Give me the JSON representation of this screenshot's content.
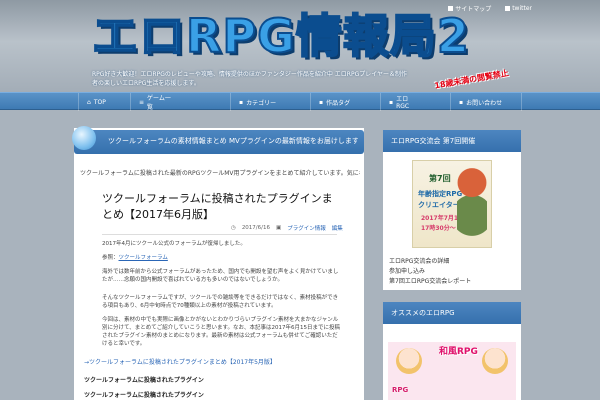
{
  "top_links": {
    "sitemap": "サイトマップ",
    "twitter": "twitter"
  },
  "header": {
    "logo": "エロRPG情報局2",
    "tagline": "RPG好き大歓迎！エロRPGのレビューや攻略、情報提供のほかファンタジー作品を紹介中 エロRPGプレイヤー＆制作者の楽しいエロRPG生活を応援します。",
    "age_notice": "18歳未満の閲覧禁止"
  },
  "nav": [
    {
      "icon": "house-icon",
      "glyph": "⌂",
      "label": "TOP"
    },
    {
      "icon": "list-icon",
      "glyph": "≡",
      "label": "ゲーム一覧"
    },
    {
      "icon": "folder-icon",
      "glyph": "▪",
      "label": "カテゴリー"
    },
    {
      "icon": "tag-icon",
      "glyph": "▪",
      "label": "作品タグ"
    },
    {
      "icon": "info-icon",
      "glyph": "▪",
      "label": "エロ RGC"
    },
    {
      "icon": "mail-icon",
      "glyph": "▪",
      "label": "お問い合わせ"
    }
  ],
  "post": {
    "header_title": "ツクールフォーラムの素材情報まとめ MVプラグインの最新情報をお届けします（定期更新）",
    "intro": "ツクールフォーラムに投稿された最新のRPGツクールMV用プラグインをまとめて紹介しています。気になるものがあればチェックしてみてください。",
    "title": "ツクールフォーラムに投稿されたプラグインまとめ【2017年6月版】",
    "date": "2017/6/16",
    "category": "プラグイン情報",
    "edit": "編集",
    "p1": "2017年4月にツクール公式のフォーラムが復帰しました。",
    "p2_prefix": "参照：",
    "p2_link": "ツクールフォーラム",
    "p3": "海外では数年前から公式フォーラムがあったため、国内でも開設を望む声をよく見かけていましたが……念願の国内開設で喜ばれている方も多いのではないでしょうか。",
    "p4": "そんなツクールフォーラムですが、ツクールでの雑談等をできるだけではなく、素材投稿ができる項目もあり、6月中旬時点で70種類以上の素材が投稿されています。",
    "p5": "今回は、素材の中でも実際に画像とかがないとわかりづらいプラグイン素材を大まかなジャンル別に分けて、まとめてご紹介していこうと思います。なお、本記事は2017年6月15日までに投稿されたプラグイン素材のまとめになります。最新の素材は公式フォーラムも併せてご確認いただけると幸いです。",
    "arrow_link": "→ツクールフォーラムに投稿されたプラグインまとめ【2017年5月版】",
    "bold1": "ツクールフォーラムに投稿されたプラグイン",
    "bold2": "ツクールフォーラムに投稿されたプラグイン"
  },
  "sidebar": {
    "box1_title": "エロRPG交流会 第7回開催",
    "banner": {
      "num": "第7回",
      "line1": "年齢指定RPG",
      "line2": "クリエイター交流会",
      "date": "2017年7月1日",
      "time": "17時30分～"
    },
    "box1_lines": [
      "エロRPG交流会の詳細",
      "参加申し込み",
      "第7回エロRPG交流会レポート"
    ],
    "box2_title": "オススメのエロRPG",
    "ad_label1": "RPG",
    "ad_label2": "和風RPG"
  },
  "colors": {
    "accent": "#3570ad",
    "logo": "#3aa0e6",
    "warning": "#e60012"
  }
}
